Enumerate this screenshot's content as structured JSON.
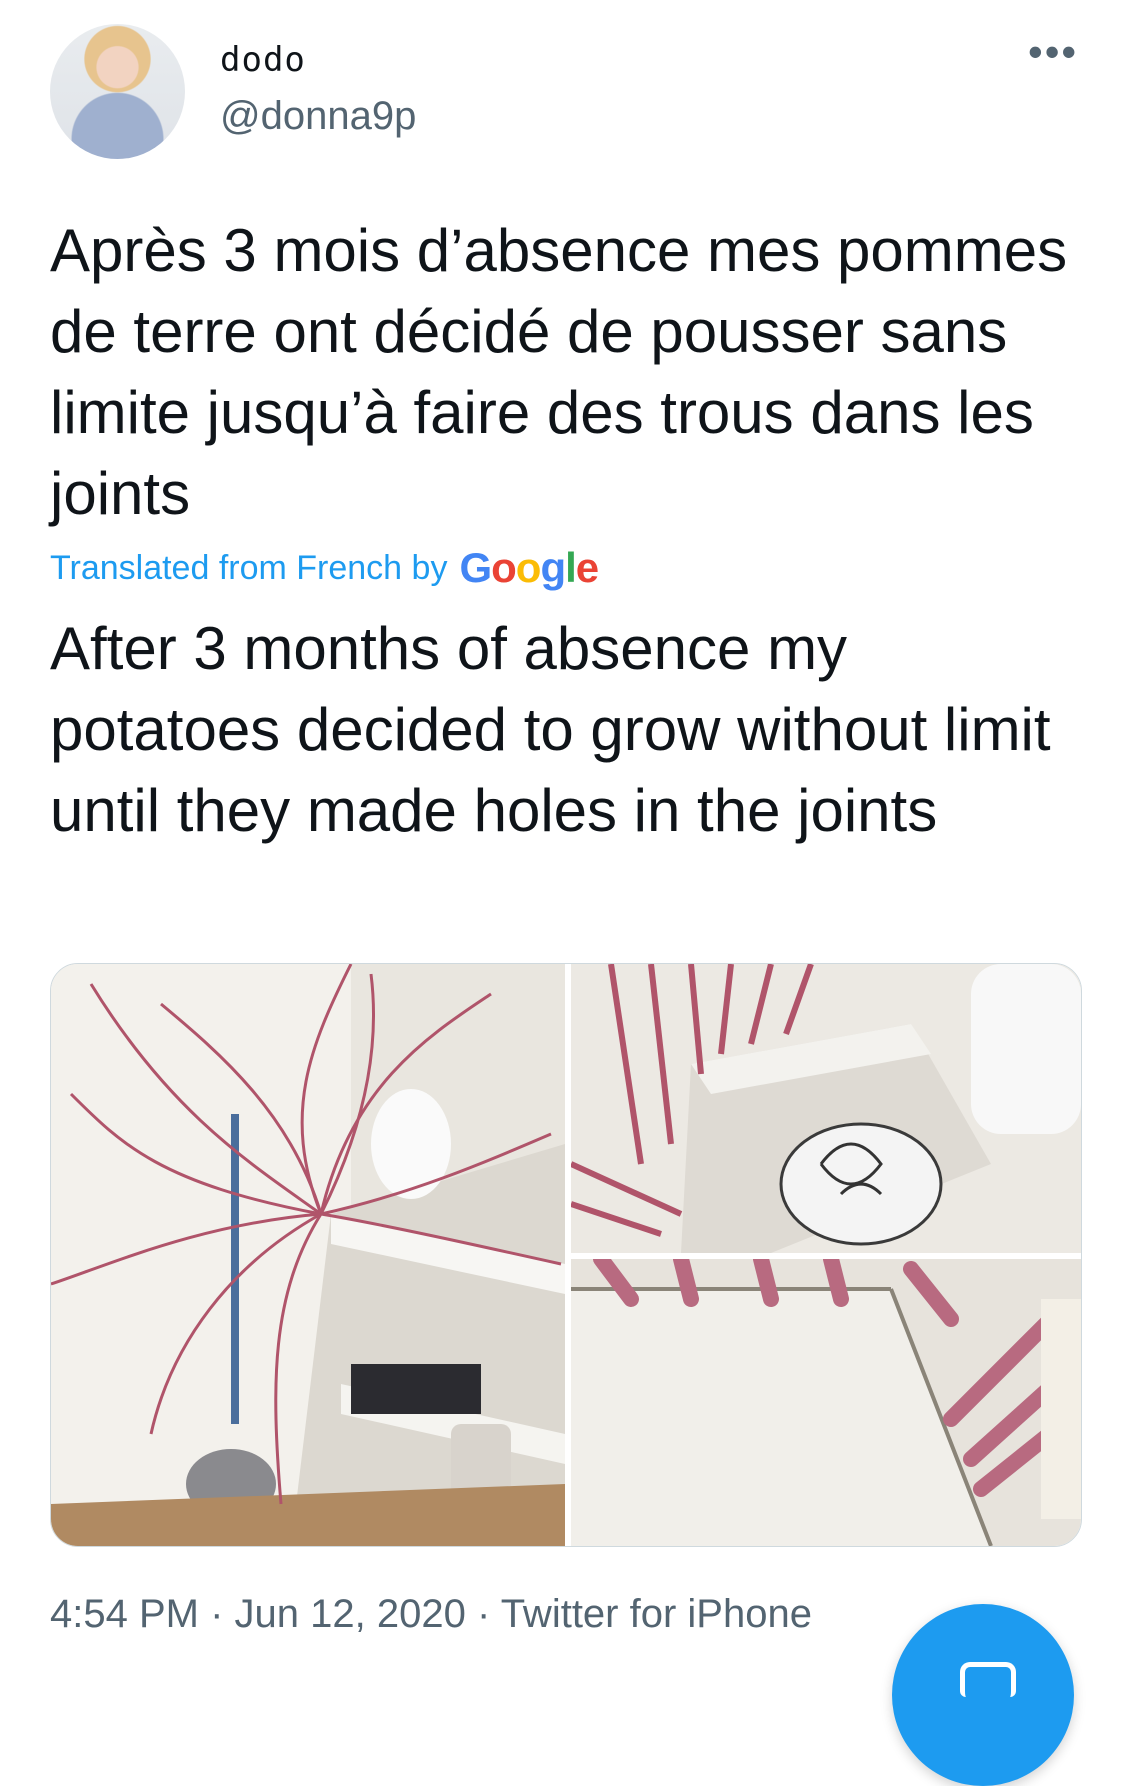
{
  "header": {
    "display_name": "dodo",
    "handle": "@donna9p",
    "more_icon": "more-horizontal-icon",
    "more_glyph": "•••"
  },
  "tweet": {
    "text": "Après 3 mois d’absence mes pommes de terre ont décidé de pousser sans limite jusqu’à faire des trous dans les joints",
    "translation_label": "Translated from French by",
    "translation_provider": "Google",
    "translated_text": "After 3 months of absence my potatoes decided to grow without limit until they made holes in the joints",
    "media_count": 3,
    "time": "4:54 PM",
    "date": "Jun 12, 2020",
    "source": "Twitter for iPhone",
    "separator": "·"
  },
  "compose_button": {
    "icon": "compose-icon",
    "color": "#1d9bf0"
  },
  "colors": {
    "text": "#0f1419",
    "secondary": "#536471",
    "link": "#1d9bf0",
    "google_blue": "#4285f4",
    "google_red": "#ea4335",
    "google_yellow": "#fbbc05",
    "google_green": "#34a853"
  }
}
